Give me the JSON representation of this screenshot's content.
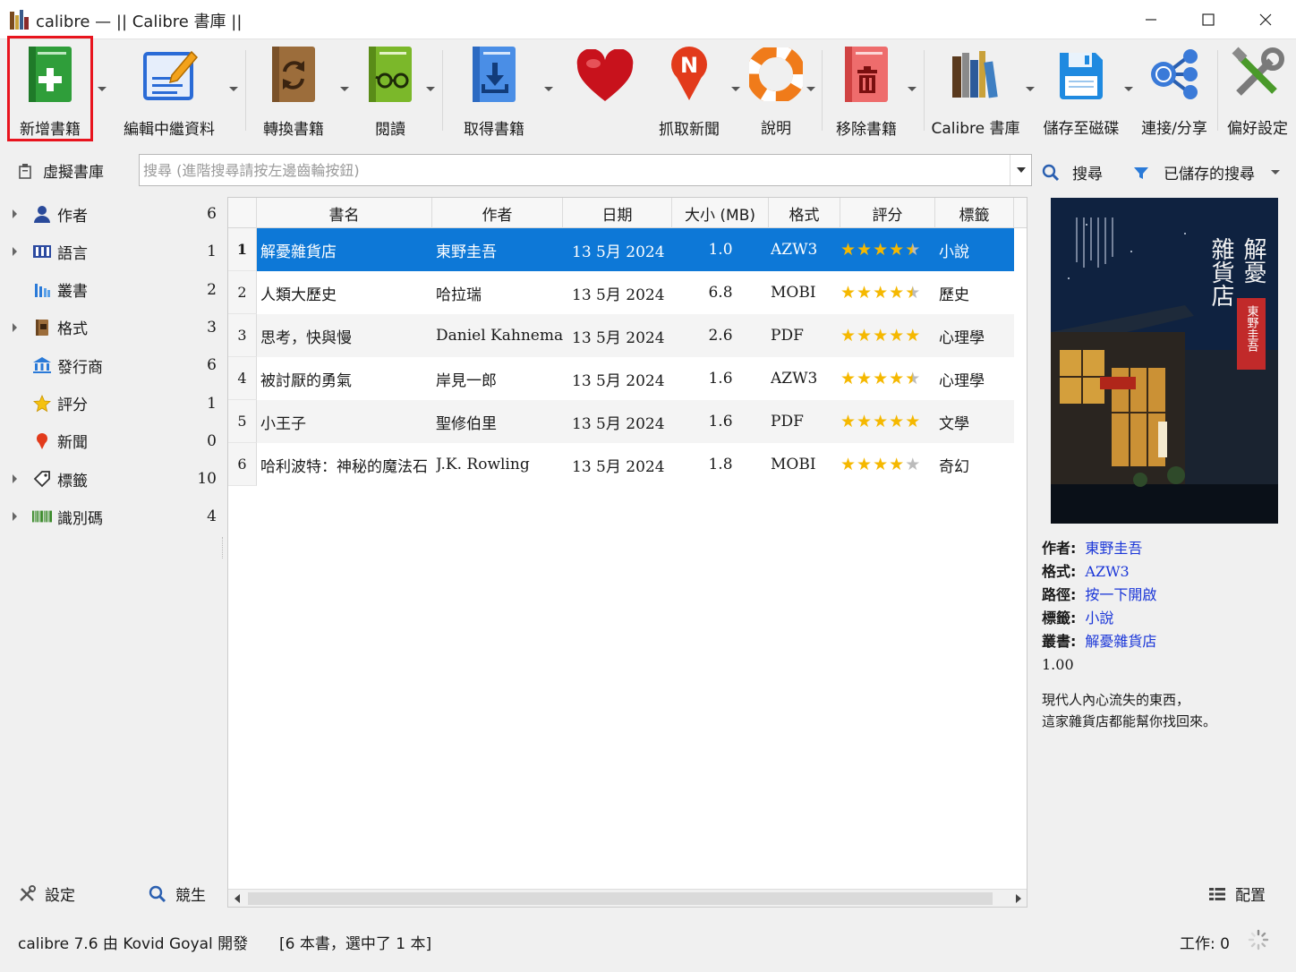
{
  "window": {
    "title": "calibre — || Calibre 書庫 ||"
  },
  "toolbar": {
    "add_books": "新增書籍",
    "edit_metadata": "編輯中繼資料",
    "convert_books": "轉換書籍",
    "view": "閱讀",
    "get_books": "取得書籍",
    "fetch_news": "抓取新聞",
    "help": "說明",
    "remove_books": "移除書籍",
    "library": "Calibre 書庫",
    "save_to_disk": "儲存至磁碟",
    "connect_share": "連接/分享",
    "preferences": "偏好設定"
  },
  "search": {
    "virtual_library": "虛擬書庫",
    "placeholder": "搜尋 (進階搜尋請按左邊齒輪按鈕)",
    "search_button": "搜尋",
    "saved_searches": "已儲存的搜尋"
  },
  "tag_browser": {
    "items": [
      {
        "name": "作者",
        "count": "6",
        "expandable": true,
        "icon": "person-icon"
      },
      {
        "name": "語言",
        "count": "1",
        "expandable": true,
        "icon": "language-icon"
      },
      {
        "name": "叢書",
        "count": "2",
        "expandable": false,
        "icon": "series-icon"
      },
      {
        "name": "格式",
        "count": "3",
        "expandable": true,
        "icon": "format-icon"
      },
      {
        "name": "發行商",
        "count": "6",
        "expandable": false,
        "icon": "publisher-icon"
      },
      {
        "name": "評分",
        "count": "1",
        "expandable": false,
        "icon": "star-icon"
      },
      {
        "name": "新聞",
        "count": "0",
        "expandable": false,
        "icon": "news-icon"
      },
      {
        "name": "標籤",
        "count": "10",
        "expandable": true,
        "icon": "tag-icon"
      },
      {
        "name": "識別碼",
        "count": "4",
        "expandable": true,
        "icon": "barcode-icon"
      }
    ],
    "settings": "設定",
    "find": "競生"
  },
  "book_list": {
    "columns": [
      "書名",
      "作者",
      "日期",
      "大小 (MB)",
      "格式",
      "評分",
      "標籤"
    ],
    "rows": [
      {
        "num": "1",
        "title": "解憂雜貨店",
        "author": "東野圭吾",
        "date": "13 5月 2024",
        "size": "1.0",
        "format": "AZW3",
        "rating": 4.5,
        "tags": "小說",
        "selected": true
      },
      {
        "num": "2",
        "title": "人類大歷史",
        "author": "哈拉瑞",
        "date": "13 5月 2024",
        "size": "6.8",
        "format": "MOBI",
        "rating": 4.5,
        "tags": "歷史",
        "selected": false
      },
      {
        "num": "3",
        "title": "思考，快與慢",
        "author": "Daniel Kahneman",
        "date": "13 5月 2024",
        "size": "2.6",
        "format": "PDF",
        "rating": 5,
        "tags": "心理學",
        "selected": false
      },
      {
        "num": "4",
        "title": "被討厭的勇氣",
        "author": "岸見一郎",
        "date": "13 5月 2024",
        "size": "1.6",
        "format": "AZW3",
        "rating": 4.5,
        "tags": "心理學",
        "selected": false
      },
      {
        "num": "5",
        "title": "小王子",
        "author": "聖修伯里",
        "date": "13 5月 2024",
        "size": "1.6",
        "format": "PDF",
        "rating": 5,
        "tags": "文學",
        "selected": false
      },
      {
        "num": "6",
        "title": "哈利波特：神秘的魔法石",
        "author": "J.K. Rowling",
        "date": "13 5月 2024",
        "size": "1.8",
        "format": "MOBI",
        "rating": 4,
        "tags": "奇幻",
        "selected": false
      }
    ]
  },
  "details": {
    "cover_title": "解憂雜貨店",
    "cover_author": "東野圭吾",
    "author_label": "作者:",
    "author": "東野圭吾",
    "format_label": "格式:",
    "format": "AZW3",
    "path_label": "路徑:",
    "path": "按一下開啟",
    "tags_label": "標籤:",
    "tags": "小說",
    "series_label": "叢書:",
    "series": "解憂雜貨店",
    "series_index": "1.00",
    "comment_line1": "現代人內心流失的東西，",
    "comment_line2": "這家雜貨店都能幫你找回來。",
    "layout_button": "配置"
  },
  "status": {
    "version": "calibre 7.6 由 Kovid Goyal 開發",
    "selection": "[6 本書，選中了 1 本]",
    "jobs": "工作: 0"
  },
  "colors": {
    "selection": "#0d78d7",
    "highlight_border": "#e8141e",
    "link": "#1a36d8",
    "star": "#f5b800"
  }
}
